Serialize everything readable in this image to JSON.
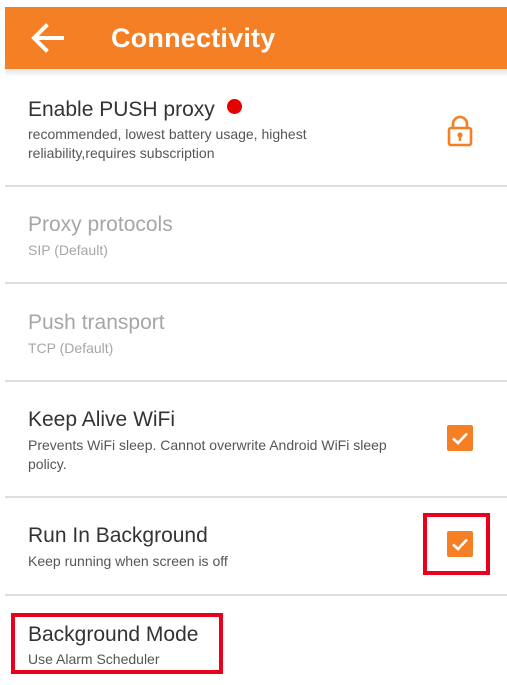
{
  "app_bar": {
    "title": "Connectivity",
    "back_icon": "arrow-left-icon",
    "color": "#f47f24"
  },
  "settings": [
    {
      "title": "Enable PUSH proxy",
      "subtitle": "recommended, lowest battery usage, highest reliability,requires subscription",
      "enabled": true,
      "status_dot_color": "#e60000",
      "trailing": "lock-icon"
    },
    {
      "title": "Proxy protocols",
      "subtitle": "SIP (Default)",
      "enabled": false
    },
    {
      "title": "Push transport",
      "subtitle": "TCP (Default)",
      "enabled": false
    },
    {
      "title": "Keep Alive WiFi",
      "subtitle": "Prevents WiFi sleep. Cannot overwrite Android WiFi sleep policy.",
      "enabled": true,
      "checked": true
    },
    {
      "title": "Run In Background",
      "subtitle": "Keep running when screen is off",
      "enabled": true,
      "checked": true
    },
    {
      "title": "Background Mode",
      "subtitle": "Use Alarm Scheduler",
      "enabled": true
    }
  ],
  "colors": {
    "accent": "#f47f24",
    "highlight": "#e8001c",
    "disabled_text": "#a6a6a6"
  }
}
